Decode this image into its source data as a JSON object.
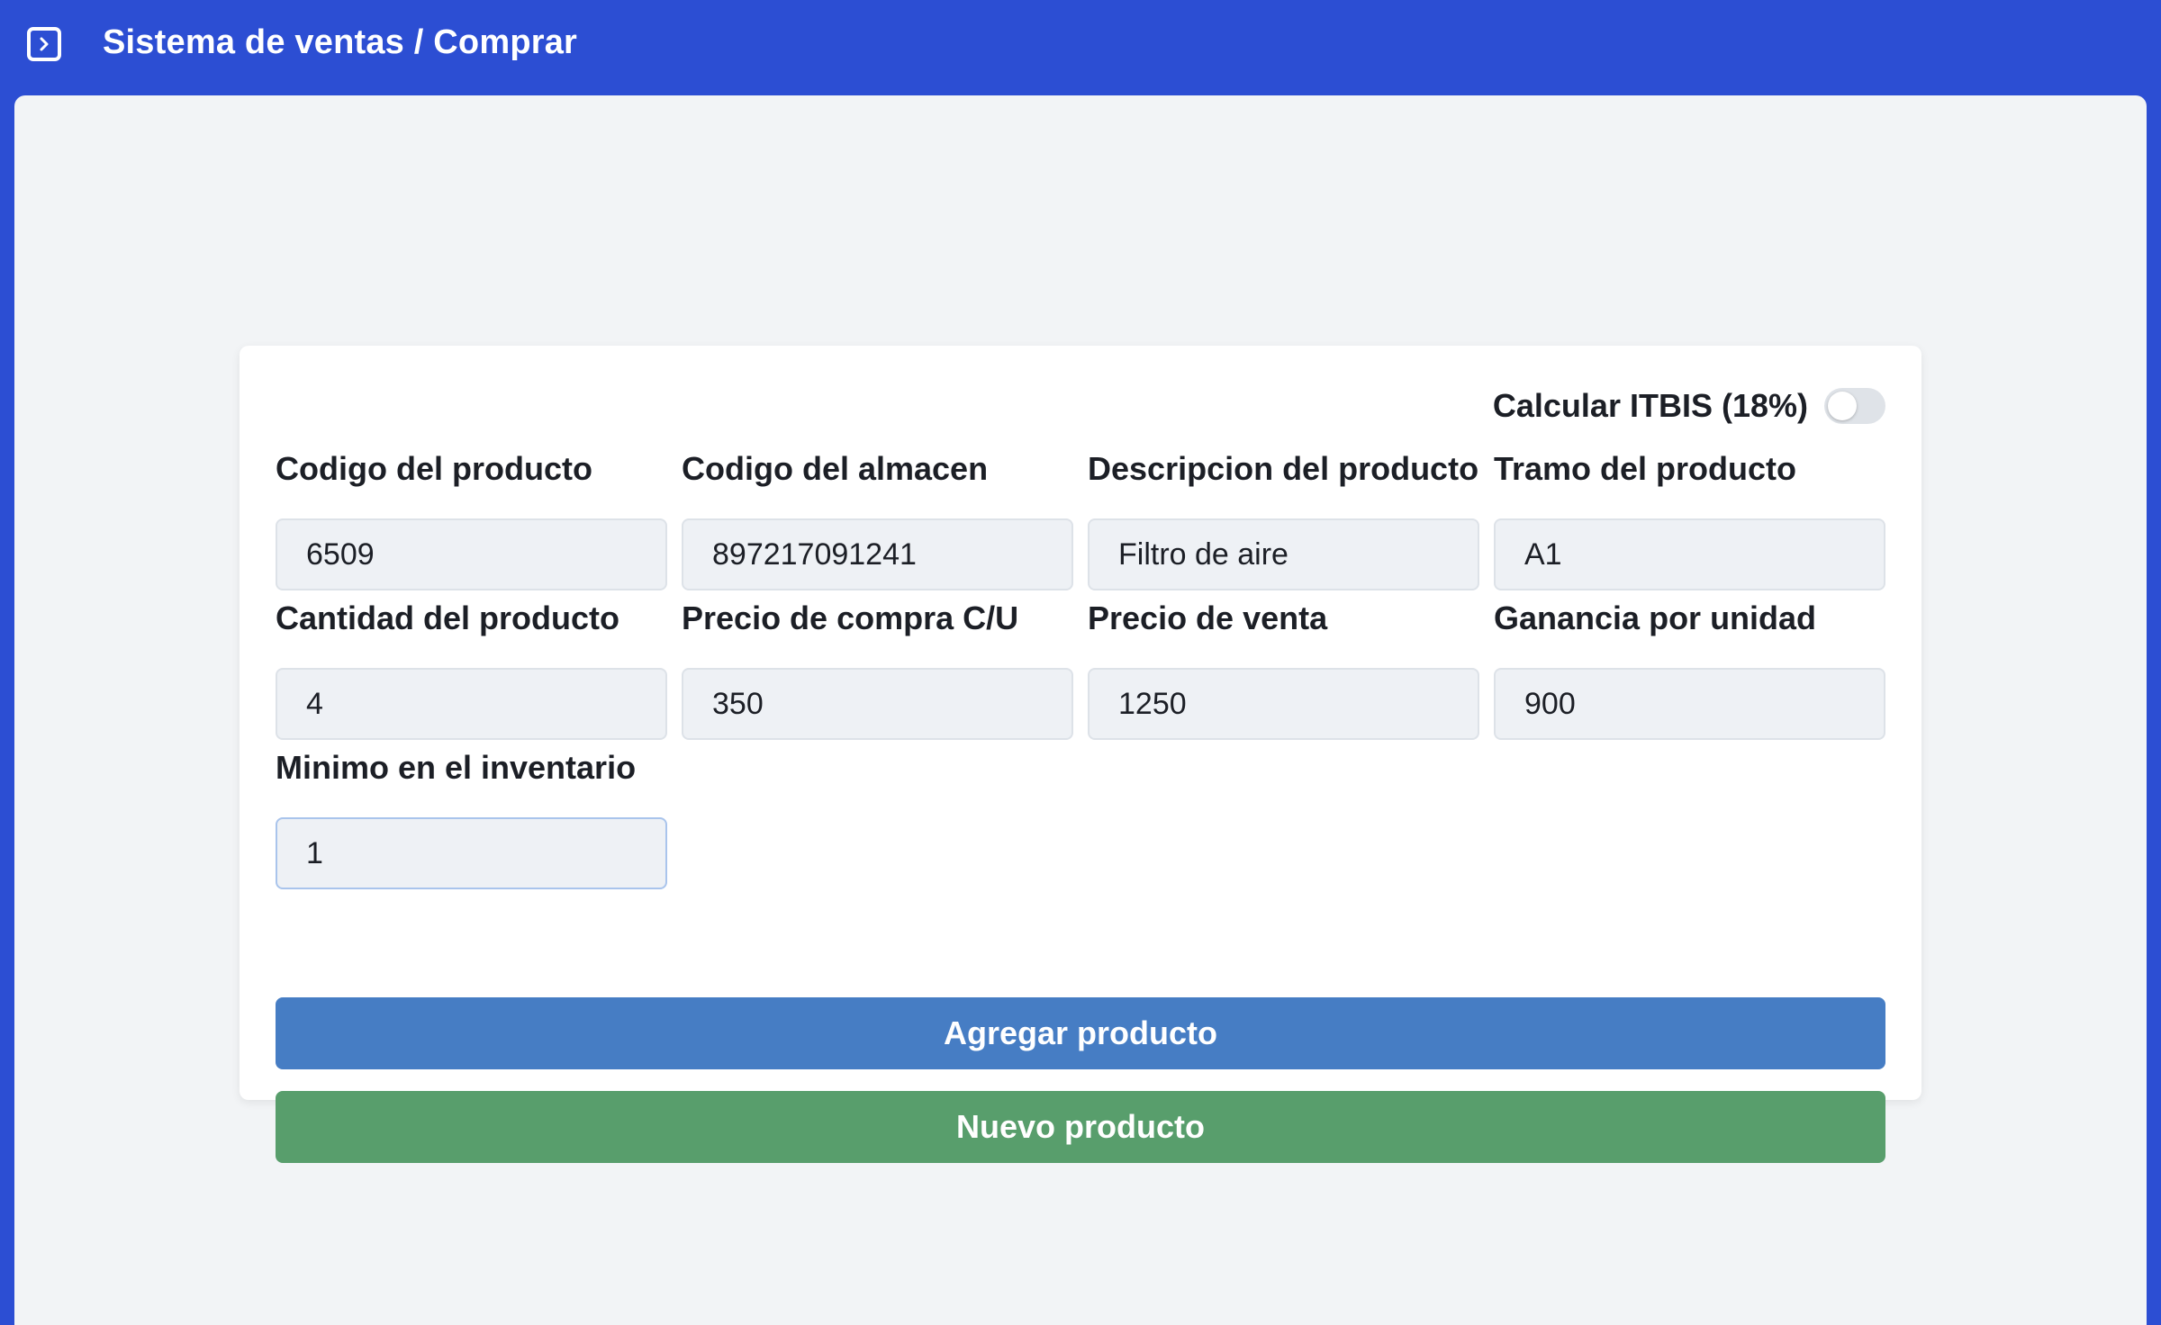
{
  "header": {
    "breadcrumb": "Sistema de ventas / Comprar",
    "toggle_icon": "sidebar-toggle-icon"
  },
  "colors": {
    "topbar": "#2c4ed3",
    "add_button": "#467dc4",
    "new_button": "#589e6c",
    "background": "#f2f4f6"
  },
  "form": {
    "itbis_label": "Calcular ITBIS (18%)",
    "itbis_enabled": false,
    "fields": [
      {
        "label": "Codigo del producto",
        "value": "6509"
      },
      {
        "label": "Codigo del almacen",
        "value": "897217091241"
      },
      {
        "label": "Descripcion del producto",
        "value": "Filtro de aire"
      },
      {
        "label": "Tramo del producto",
        "value": "A1"
      },
      {
        "label": "Cantidad del producto",
        "value": "4"
      },
      {
        "label": "Precio de compra C/U",
        "value": "350"
      },
      {
        "label": "Precio de venta",
        "value": "1250"
      },
      {
        "label": "Ganancia por unidad",
        "value": "900"
      },
      {
        "label": "Minimo en el inventario",
        "value": "1"
      }
    ],
    "add_button": "Agregar producto",
    "new_button": "Nuevo producto"
  }
}
